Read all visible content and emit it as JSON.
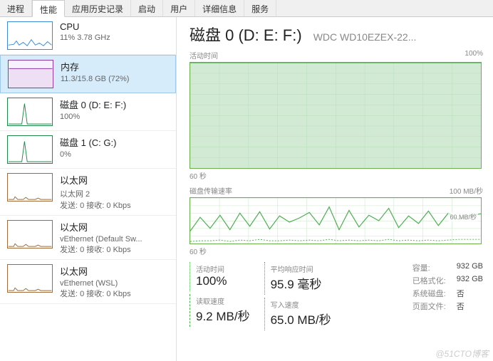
{
  "tabs": [
    "进程",
    "性能",
    "应用历史记录",
    "启动",
    "用户",
    "详细信息",
    "服务"
  ],
  "active_tab_index": 1,
  "sidebar": [
    {
      "id": "cpu",
      "title": "CPU",
      "sub": "11%  3.78 GHz",
      "thumb": "cpu"
    },
    {
      "id": "mem",
      "title": "内存",
      "sub": "11.3/15.8 GB (72%)",
      "thumb": "mem",
      "selected": true
    },
    {
      "id": "disk0",
      "title": "磁盘 0 (D: E: F:)",
      "sub": "100%",
      "thumb": "disk"
    },
    {
      "id": "disk1",
      "title": "磁盘 1 (C: G:)",
      "sub": "0%",
      "thumb": "disk"
    },
    {
      "id": "eth1",
      "title": "以太网",
      "sub": "以太网 2",
      "extra": "发送: 0 接收: 0 Kbps",
      "thumb": "eth"
    },
    {
      "id": "eth2",
      "title": "以太网",
      "sub": "vEthernet (Default Sw...",
      "extra": "发送: 0 接收: 0 Kbps",
      "thumb": "eth"
    },
    {
      "id": "eth3",
      "title": "以太网",
      "sub": "vEthernet (WSL)",
      "extra": "发送: 0 接收: 0 Kbps",
      "thumb": "eth"
    }
  ],
  "detail": {
    "title": "磁盘 0 (D: E: F:)",
    "model": "WDC WD10EZEX-22...",
    "chart1": {
      "label": "活动时间",
      "ymax": "100%",
      "xaxis": "60 秒"
    },
    "chart2": {
      "label": "磁盘传输速率",
      "ymax": "100 MB/秒",
      "mid": "60 MB/秒",
      "xaxis": "60 秒"
    },
    "stats": {
      "active_time_lbl": "活动时间",
      "active_time_val": "100%",
      "avg_resp_lbl": "平均响应时间",
      "avg_resp_val": "95.9 毫秒",
      "read_lbl": "读取速度",
      "read_val": "9.2 MB/秒",
      "write_lbl": "写入速度",
      "write_val": "65.0 MB/秒"
    },
    "right": {
      "capacity_k": "容量:",
      "capacity_v": "932 GB",
      "formatted_k": "已格式化:",
      "formatted_v": "932 GB",
      "sysdisk_k": "系统磁盘:",
      "sysdisk_v": "否",
      "pagefile_k": "页面文件:",
      "pagefile_v": "否"
    }
  },
  "watermark": "@51CTO博客",
  "chart_data": [
    {
      "type": "area",
      "title": "活动时间",
      "ylabel": "%",
      "ylim": [
        0,
        100
      ],
      "x": "60s window",
      "values": [
        100,
        100,
        100,
        100,
        100,
        100,
        100,
        100,
        100,
        100,
        100,
        100,
        100,
        100,
        100,
        100,
        100,
        100,
        100,
        100,
        100,
        100,
        100,
        100,
        100,
        100,
        100,
        100,
        100,
        100
      ]
    },
    {
      "type": "line",
      "title": "磁盘传输速率",
      "ylabel": "MB/秒",
      "ylim": [
        0,
        100
      ],
      "x": "60s window",
      "series": [
        {
          "name": "写入",
          "values": [
            28,
            58,
            34,
            62,
            30,
            66,
            38,
            70,
            32,
            60,
            46,
            56,
            68,
            40,
            80,
            30,
            74,
            36,
            62,
            50,
            78,
            34,
            60,
            44,
            72,
            38,
            66,
            52,
            60,
            65
          ]
        },
        {
          "name": "读取",
          "values": [
            4,
            6,
            5,
            8,
            4,
            7,
            6,
            9,
            5,
            6,
            8,
            5,
            7,
            6,
            10,
            5,
            8,
            6,
            7,
            5,
            9,
            6,
            7,
            5,
            8,
            6,
            7,
            8,
            9,
            9
          ]
        }
      ]
    }
  ]
}
